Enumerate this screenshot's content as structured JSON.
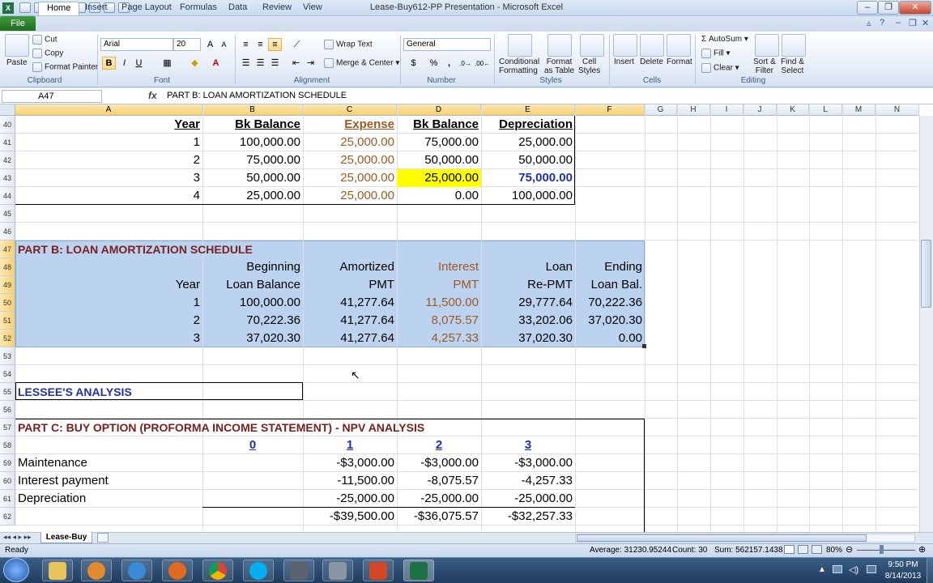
{
  "window": {
    "title": "Lease-Buy612-PP Presentation - Microsoft Excel",
    "controls": {
      "minimize": "–",
      "maximize": "❐",
      "close": "✕"
    }
  },
  "ribbon_tabs": [
    "File",
    "Home",
    "Insert",
    "Page Layout",
    "Formulas",
    "Data",
    "Review",
    "View"
  ],
  "ribbon": {
    "clipboard": {
      "label": "Clipboard",
      "paste": "Paste",
      "cut": "Cut",
      "copy": "Copy",
      "format_painter": "Format Painter"
    },
    "font": {
      "label": "Font",
      "name": "Arial",
      "size": "20",
      "bold": "B",
      "italic": "I",
      "underline": "U"
    },
    "alignment": {
      "label": "Alignment",
      "wrap_text": "Wrap Text",
      "merge_center": "Merge & Center"
    },
    "number": {
      "label": "Number",
      "format": "General",
      "currency": "$",
      "percent": "%",
      "comma": ","
    },
    "styles": {
      "label": "Styles",
      "conditional": [
        "Conditional",
        "Formatting"
      ],
      "format_table": [
        "Format",
        "as Table"
      ],
      "cell_styles": [
        "Cell",
        "Styles"
      ]
    },
    "cells": {
      "label": "Cells",
      "insert": "Insert",
      "delete": "Delete",
      "format": "Format"
    },
    "editing": {
      "label": "Editing",
      "autosum": "AutoSum",
      "fill": "Fill",
      "clear": "Clear",
      "sort_filter": [
        "Sort &",
        "Filter"
      ],
      "find_select": [
        "Find &",
        "Select"
      ]
    }
  },
  "formula_bar": {
    "name_box": "A47",
    "fx": "fx",
    "formula": "PART B: LOAN AMORTIZATION SCHEDULE"
  },
  "columns": [
    "A",
    "B",
    "C",
    "D",
    "E",
    "F",
    "G",
    "H",
    "I",
    "J",
    "K",
    "L",
    "M",
    "N"
  ],
  "rows": [
    "40",
    "41",
    "42",
    "43",
    "44",
    "45",
    "46",
    "47",
    "48",
    "49",
    "50",
    "51",
    "52",
    "53",
    "54",
    "55",
    "56",
    "57",
    "58",
    "59",
    "60",
    "61",
    "62"
  ],
  "depreciation_table": {
    "headers": [
      "Year",
      "Bk Balance",
      "Expense",
      "Bk Balance",
      "Depreciation"
    ],
    "rows": [
      [
        "1",
        "100,000.00",
        "25,000.00",
        "75,000.00",
        "25,000.00"
      ],
      [
        "2",
        "75,000.00",
        "25,000.00",
        "50,000.00",
        "50,000.00"
      ],
      [
        "3",
        "50,000.00",
        "25,000.00",
        "25,000.00",
        "75,000.00"
      ],
      [
        "4",
        "25,000.00",
        "25,000.00",
        "0.00",
        "100,000.00"
      ]
    ]
  },
  "part_b": {
    "title": "PART B: LOAN AMORTIZATION SCHEDULE",
    "header1": [
      "",
      "Beginning",
      "Amortized",
      "Interest",
      "Loan",
      "Ending"
    ],
    "header2": [
      "Year",
      "Loan Balance",
      "PMT",
      "PMT",
      "Re-PMT",
      "Loan Bal."
    ],
    "rows": [
      [
        "1",
        "100,000.00",
        "41,277.64",
        "11,500.00",
        "29,777.64",
        "70,222.36"
      ],
      [
        "2",
        "70,222.36",
        "41,277.64",
        "8,075.57",
        "33,202.06",
        "37,020.30"
      ],
      [
        "3",
        "37,020.30",
        "41,277.64",
        "4,257.33",
        "37,020.30",
        "0.00"
      ]
    ]
  },
  "lessee_title": "LESSEE'S ANALYSIS",
  "part_c": {
    "title": "PART C: BUY OPTION (PROFORMA INCOME STATEMENT) - NPV ANALYSIS",
    "periods": [
      "0",
      "1",
      "2",
      "3"
    ],
    "rows": [
      {
        "label": "Maintenance",
        "values": [
          "-$3,000.00",
          "-$3,000.00",
          "-$3,000.00"
        ]
      },
      {
        "label": "Interest payment",
        "values": [
          "-11,500.00",
          "-8,075.57",
          "-4,257.33"
        ]
      },
      {
        "label": "Depreciation",
        "values": [
          "-25,000.00",
          "-25,000.00",
          "-25,000.00"
        ]
      },
      {
        "label": "",
        "values": [
          "-$39,500.00",
          "-$36,075.57",
          "-$32,257.33"
        ]
      }
    ]
  },
  "sheet_tab": "Lease-Buy",
  "status": {
    "ready": "Ready",
    "average": "Average: 31230.95244",
    "count": "Count: 30",
    "sum": "Sum: 562157.1438",
    "zoom": "80%"
  },
  "taskbar": {
    "time": "9:50 PM",
    "date": "8/14/2013"
  },
  "colors": {
    "highlight_yellow": "#ffff00",
    "selection_blue": "#bcd3f0",
    "expense_brown": "#9b5a22",
    "title_red": "#7a1f1f",
    "link_blue": "#1f2fb3"
  }
}
